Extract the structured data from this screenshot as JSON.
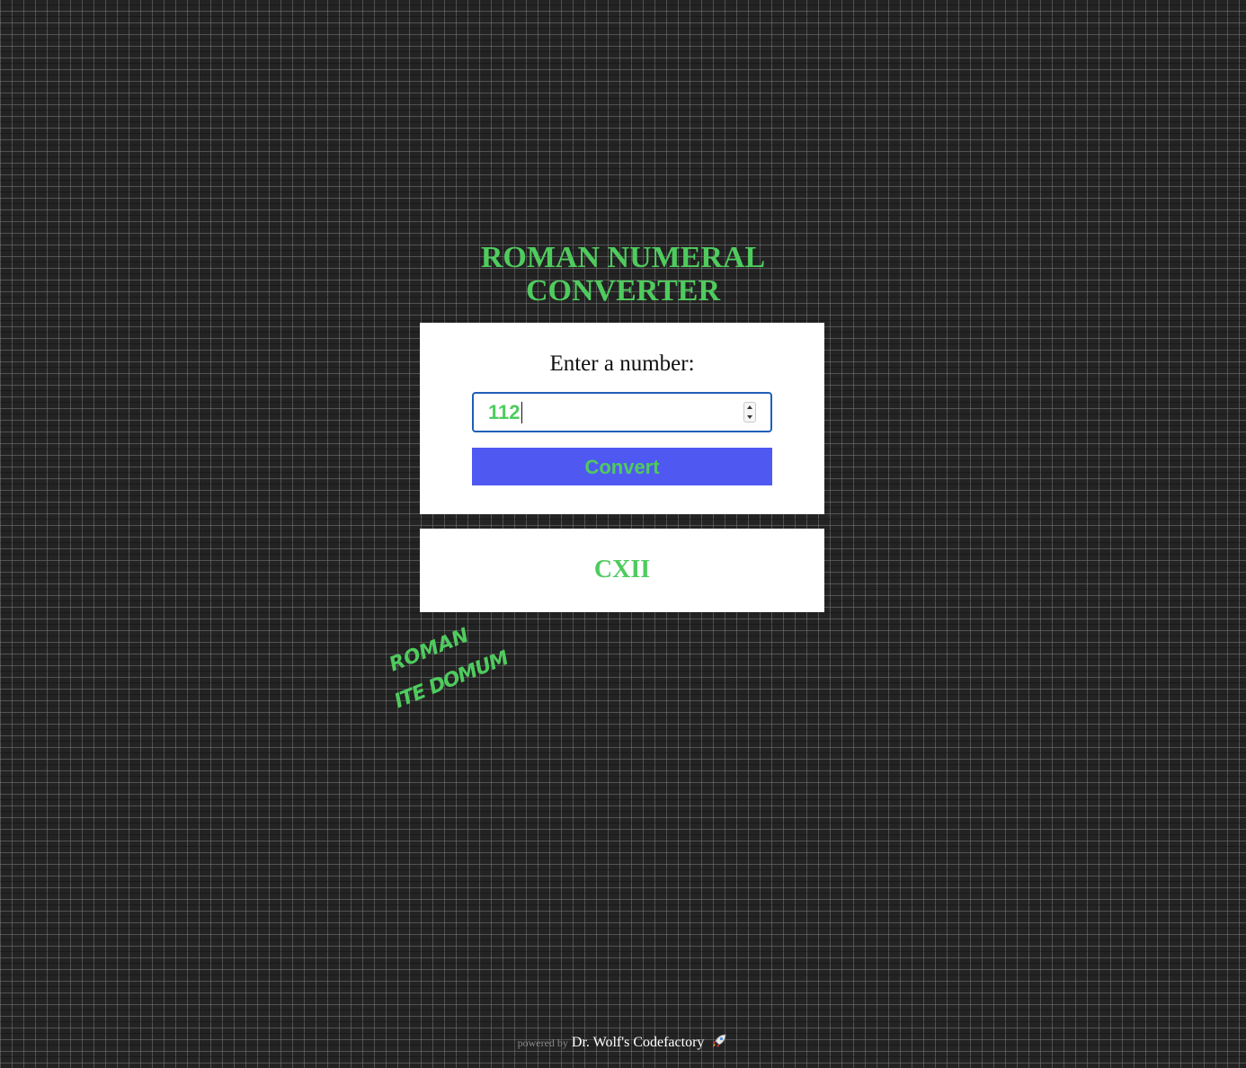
{
  "header": {
    "title_line1": "ROMAN NUMERAL",
    "title_line2": "CONVERTER"
  },
  "form": {
    "prompt": "Enter a number:",
    "input_value": "112",
    "button_label": "Convert"
  },
  "result": {
    "value": "CXII"
  },
  "graffiti": {
    "line1": "ROMAN",
    "line2": "ITE DOMUM"
  },
  "footer": {
    "powered_by": "powered by",
    "brand": "Dr. Wolf's Codefactory"
  },
  "colors": {
    "accent_green": "#4fcb5e",
    "button_bg": "#5058f2",
    "background": "#232323"
  },
  "icons": {
    "footer": "rocket-icon",
    "input": "spinner-icon"
  }
}
